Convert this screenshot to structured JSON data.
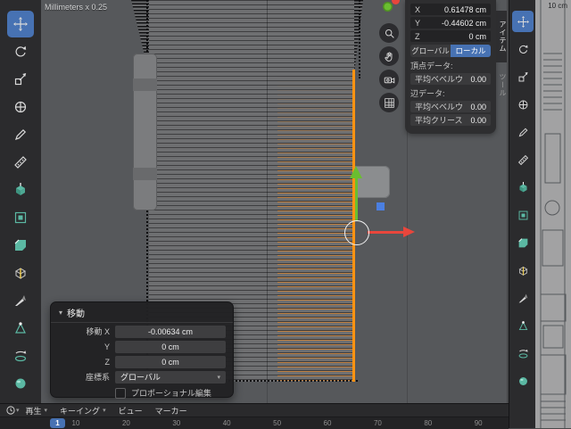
{
  "viewport": {
    "units_label": "Millimeters x 0.25"
  },
  "tools": [
    {
      "name": "move",
      "active": true
    },
    {
      "name": "rotate",
      "active": false
    },
    {
      "name": "scale",
      "active": false
    },
    {
      "name": "transform",
      "active": false
    },
    {
      "name": "annotate",
      "active": false
    },
    {
      "name": "measure",
      "active": false
    },
    {
      "name": "extrude",
      "active": false
    },
    {
      "name": "inset",
      "active": false
    },
    {
      "name": "bevel",
      "active": false
    },
    {
      "name": "loop-cut",
      "active": false
    },
    {
      "name": "knife",
      "active": false
    },
    {
      "name": "poly-build",
      "active": false
    },
    {
      "name": "spin",
      "active": false
    },
    {
      "name": "smooth",
      "active": false
    }
  ],
  "nav_buttons": [
    {
      "name": "zoom"
    },
    {
      "name": "pan"
    },
    {
      "name": "camera"
    },
    {
      "name": "grid"
    }
  ],
  "n_panel": {
    "tabs": [
      {
        "key": "item",
        "label": "アイテム",
        "active": true
      },
      {
        "key": "tool",
        "label": "ツール",
        "active": false
      }
    ],
    "transform_rows": [
      {
        "key": "x",
        "label": "X",
        "value": "0.61478 cm"
      },
      {
        "key": "y",
        "label": "Y",
        "value": "-0.44602 cm"
      },
      {
        "key": "z",
        "label": "Z",
        "value": "0 cm"
      }
    ],
    "orientation_buttons": [
      {
        "key": "global",
        "label": "グローバル",
        "active": false
      },
      {
        "key": "local",
        "label": "ローカル",
        "active": true
      }
    ],
    "vertex_data_label": "頂点データ:",
    "vertex_rows": [
      {
        "key": "mean-bevel-weight",
        "label": "平均ベベルウ",
        "value": "0.00"
      }
    ],
    "edge_data_label": "辺データ:",
    "edge_rows": [
      {
        "key": "mean-bevel-weight",
        "label": "平均ベベルウ",
        "value": "0.00"
      },
      {
        "key": "mean-crease",
        "label": "平均クリース",
        "value": "0.00"
      }
    ]
  },
  "operator_panel": {
    "title": "移動",
    "rows": [
      {
        "key": "move-x",
        "label": "移動 X",
        "value": "-0.00634 cm"
      },
      {
        "key": "move-y",
        "label": "Y",
        "value": "0 cm"
      },
      {
        "key": "move-z",
        "label": "Z",
        "value": "0 cm"
      }
    ],
    "orientation_label": "座標系",
    "orientation_value": "グローバル",
    "proportional_label": "プロポーショナル編集"
  },
  "timeline": {
    "menus": [
      {
        "key": "play",
        "label": "再生",
        "chevron": true
      },
      {
        "key": "keying",
        "label": "キーイング",
        "chevron": true
      },
      {
        "key": "view",
        "label": "ビュー",
        "chevron": false
      },
      {
        "key": "marker",
        "label": "マーカー",
        "chevron": false
      }
    ],
    "current_frame": "1",
    "ticks": [
      10,
      20,
      30,
      40,
      50,
      60,
      70,
      80,
      90
    ]
  },
  "right_viewport": {
    "scale_label": "10 cm"
  },
  "colors": {
    "accent": "#4772b3",
    "selection_orange": "#ff9312",
    "axis_green": "#6abe30",
    "axis_red": "#e8463c",
    "axis_blue": "#4b7fe1"
  }
}
